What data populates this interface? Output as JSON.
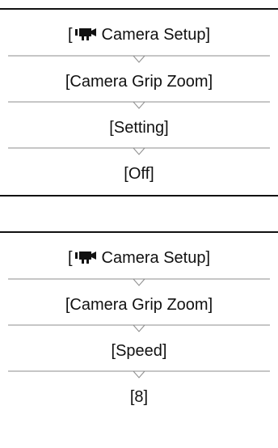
{
  "panels": [
    {
      "steps": [
        {
          "prefix": "[",
          "icon": "camera-setup-icon",
          "label": "Camera Setup]"
        },
        {
          "label": "[Camera Grip Zoom]"
        },
        {
          "label": "[Setting]"
        },
        {
          "label": "[Off]"
        }
      ]
    },
    {
      "steps": [
        {
          "prefix": "[",
          "icon": "camera-setup-icon",
          "label": "Camera Setup]"
        },
        {
          "label": "[Camera Grip Zoom]"
        },
        {
          "label": "[Speed]"
        },
        {
          "label": "[8]"
        }
      ]
    }
  ]
}
